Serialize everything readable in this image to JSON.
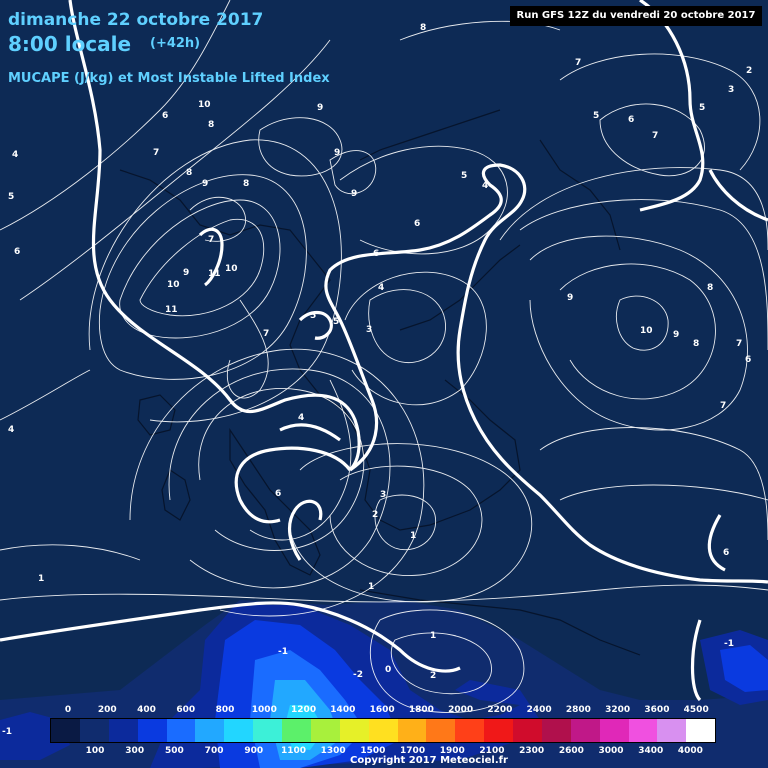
{
  "header": {
    "date": "dimanche 22 octobre 2017",
    "time": "8:00 locale",
    "lead": "(+42h)",
    "product": "MUCAPE (J/kg) et Most Instable Lifted Index",
    "run": "Run GFS 12Z du vendredi 20 octobre 2017"
  },
  "legend": {
    "top_labels": [
      "0",
      "200",
      "400",
      "600",
      "800",
      "1000",
      "1200",
      "1400",
      "1600",
      "1800",
      "2000",
      "2200",
      "2400",
      "2800",
      "3200",
      "3600",
      "4500"
    ],
    "bottom_labels": [
      "100",
      "300",
      "500",
      "700",
      "900",
      "1100",
      "1300",
      "1500",
      "1700",
      "1900",
      "2100",
      "2300",
      "2600",
      "3000",
      "3400",
      "4000"
    ],
    "colors": [
      "#0a1a44",
      "#102c6e",
      "#0c2a9c",
      "#0a3ae0",
      "#1a6cff",
      "#22a8ff",
      "#22d6ff",
      "#3cf0d8",
      "#5cf06a",
      "#a8f03c",
      "#e6f028",
      "#ffe020",
      "#ffb018",
      "#ff7818",
      "#ff4018",
      "#f01818",
      "#d00c2c",
      "#b0104c",
      "#c01888",
      "#e028b8",
      "#f050e0",
      "#d890f0",
      "#ffffff"
    ]
  },
  "labels": [
    "dimanche 22 octobre 2017"
  ],
  "contour_labels": [
    {
      "v": "8"
    },
    {
      "v": "7"
    },
    {
      "v": "2"
    },
    {
      "v": "3"
    },
    {
      "v": "5"
    },
    {
      "v": "6"
    },
    {
      "v": "7"
    },
    {
      "v": "5"
    },
    {
      "v": "6"
    },
    {
      "v": "10"
    },
    {
      "v": "8"
    },
    {
      "v": "9"
    },
    {
      "v": "9"
    },
    {
      "v": "9"
    },
    {
      "v": "8"
    },
    {
      "v": "9"
    },
    {
      "v": "7"
    },
    {
      "v": "4"
    },
    {
      "v": "5"
    },
    {
      "v": "6"
    },
    {
      "v": "10"
    },
    {
      "v": "11"
    },
    {
      "v": "9"
    },
    {
      "v": "10"
    },
    {
      "v": "11"
    },
    {
      "v": "7"
    },
    {
      "v": "6"
    },
    {
      "v": "4"
    },
    {
      "v": "5"
    },
    {
      "v": "5"
    },
    {
      "v": "3"
    },
    {
      "v": "9"
    },
    {
      "v": "10"
    },
    {
      "v": "9"
    },
    {
      "v": "8"
    },
    {
      "v": "8"
    },
    {
      "v": "7"
    },
    {
      "v": "6"
    },
    {
      "v": "7"
    },
    {
      "v": "7"
    },
    {
      "v": "4"
    },
    {
      "v": "4"
    },
    {
      "v": "6"
    },
    {
      "v": "3"
    },
    {
      "v": "2"
    },
    {
      "v": "1"
    },
    {
      "v": "6"
    },
    {
      "v": "1"
    },
    {
      "v": "1"
    },
    {
      "v": "1"
    },
    {
      "v": "2"
    },
    {
      "v": "0"
    },
    {
      "v": "-1"
    },
    {
      "v": "-2"
    },
    {
      "v": "-1"
    },
    {
      "v": "-1"
    },
    {
      "v": "8"
    },
    {
      "v": "5"
    },
    {
      "v": "6"
    },
    {
      "v": "4"
    }
  ],
  "copyright": "Copyright 2017 Meteociel.fr"
}
